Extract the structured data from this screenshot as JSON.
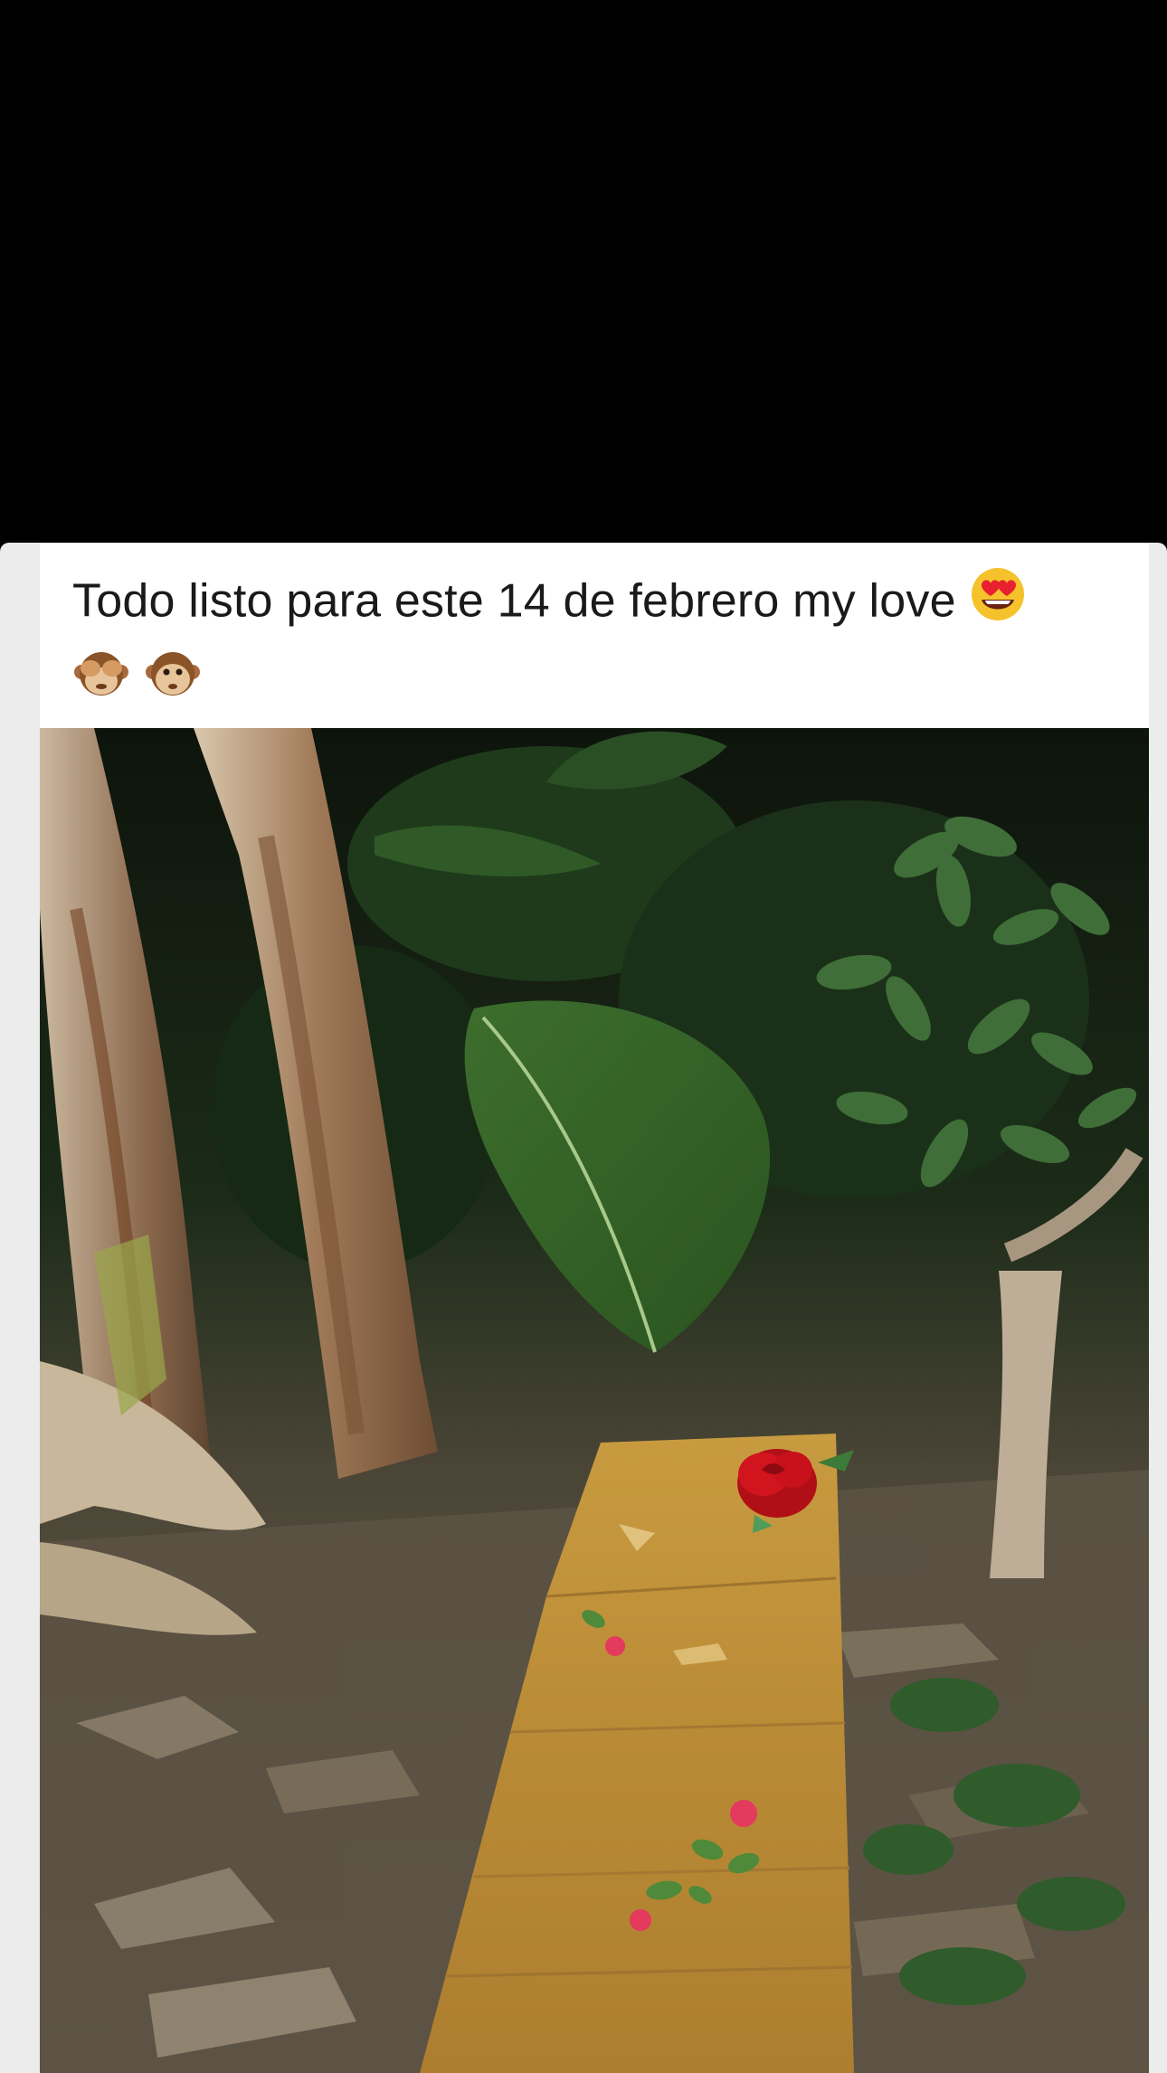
{
  "post": {
    "caption_text": "Todo listo para este 14 de febrero my love",
    "caption_emojis_inline": [
      "heart-eyes-emoji"
    ],
    "caption_emojis_line2": [
      "see-no-evil-monkey-emoji",
      "monkey-face-emoji"
    ]
  },
  "photo": {
    "description_icon": "photo-image",
    "palette": {
      "ground": "#6d604e",
      "leaf_dark": "#1f3a1c",
      "leaf_green": "#3f7a34",
      "trunk": "#a78b6e",
      "board": "#c59a3e",
      "rose": "#c8101a"
    }
  }
}
